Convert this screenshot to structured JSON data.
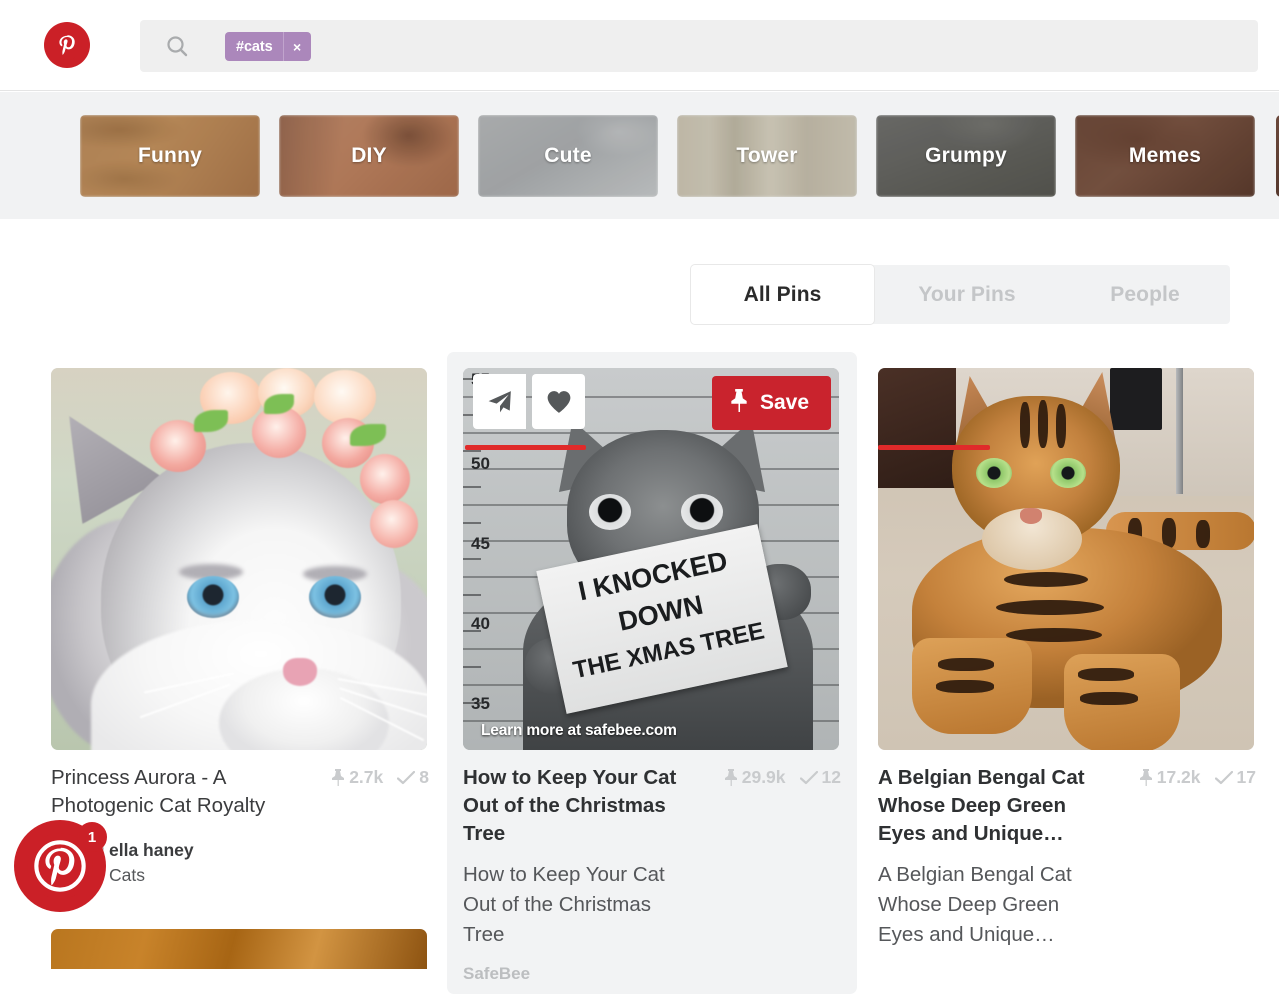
{
  "header": {
    "logo_icon": "pinterest-logo-icon",
    "search": {
      "icon": "search-icon",
      "tag_label": "#cats",
      "tag_close_label": "×",
      "placeholder": ""
    }
  },
  "categories": [
    {
      "label": "Funny",
      "bg": "bg-funny"
    },
    {
      "label": "DIY",
      "bg": "bg-diy"
    },
    {
      "label": "Cute",
      "bg": "bg-cute"
    },
    {
      "label": "Tower",
      "bg": "bg-tower"
    },
    {
      "label": "Grumpy",
      "bg": "bg-grumpy"
    },
    {
      "label": "Memes",
      "bg": "bg-memes"
    }
  ],
  "tabs": [
    {
      "label": "All Pins",
      "active": true
    },
    {
      "label": "Your Pins",
      "active": false
    },
    {
      "label": "People",
      "active": false
    }
  ],
  "hover_overlay": {
    "send_icon": "send-paper-plane-icon",
    "heart_icon": "heart-icon",
    "save_icon": "pin-icon",
    "save_label": "Save"
  },
  "pins": [
    {
      "title": "Princess Aurora - A Photogenic Cat Royalty",
      "repins": "2.7k",
      "likes": "8",
      "repin_icon": "pin-icon",
      "like_icon": "check-icon",
      "attribution": {
        "user": "ella haney",
        "board": "Cats"
      },
      "image_alt": "ragdoll-cat-with-flower-crown"
    },
    {
      "title": "How to Keep Your Cat Out of the Christmas Tree",
      "repins": "29.9k",
      "likes": "12",
      "repin_icon": "pin-icon",
      "like_icon": "check-icon",
      "description": "How to Keep Your Cat Out of the Christmas Tree",
      "source": "SafeBee",
      "image_caption": "Learn more at safebee.com",
      "image_sign_lines": [
        "I KNOCKED",
        "DOWN",
        "THE XMAS TREE"
      ],
      "image_ruler_marks": [
        "55",
        "50",
        "45",
        "40",
        "35"
      ],
      "image_alt": "cat-mugshot-meme",
      "hovered": true
    },
    {
      "title": "A Belgian Bengal Cat Whose Deep Green Eyes and Unique…",
      "repins": "17.2k",
      "likes": "17",
      "repin_icon": "pin-icon",
      "like_icon": "check-icon",
      "description": "A Belgian Bengal Cat Whose Deep Green Eyes and Unique…",
      "image_alt": "bengal-cat-on-floor"
    }
  ],
  "annotations": {
    "underline_color": "#e02a2a"
  },
  "extension_badge": {
    "icon": "pinterest-logo-icon",
    "count": "1"
  },
  "colors": {
    "brand_red": "#cb2027",
    "save_red": "#c9232d",
    "tag_purple": "#ab87bb",
    "band_gray": "#f1f2f3",
    "hover_card": "#f2f3f4"
  }
}
